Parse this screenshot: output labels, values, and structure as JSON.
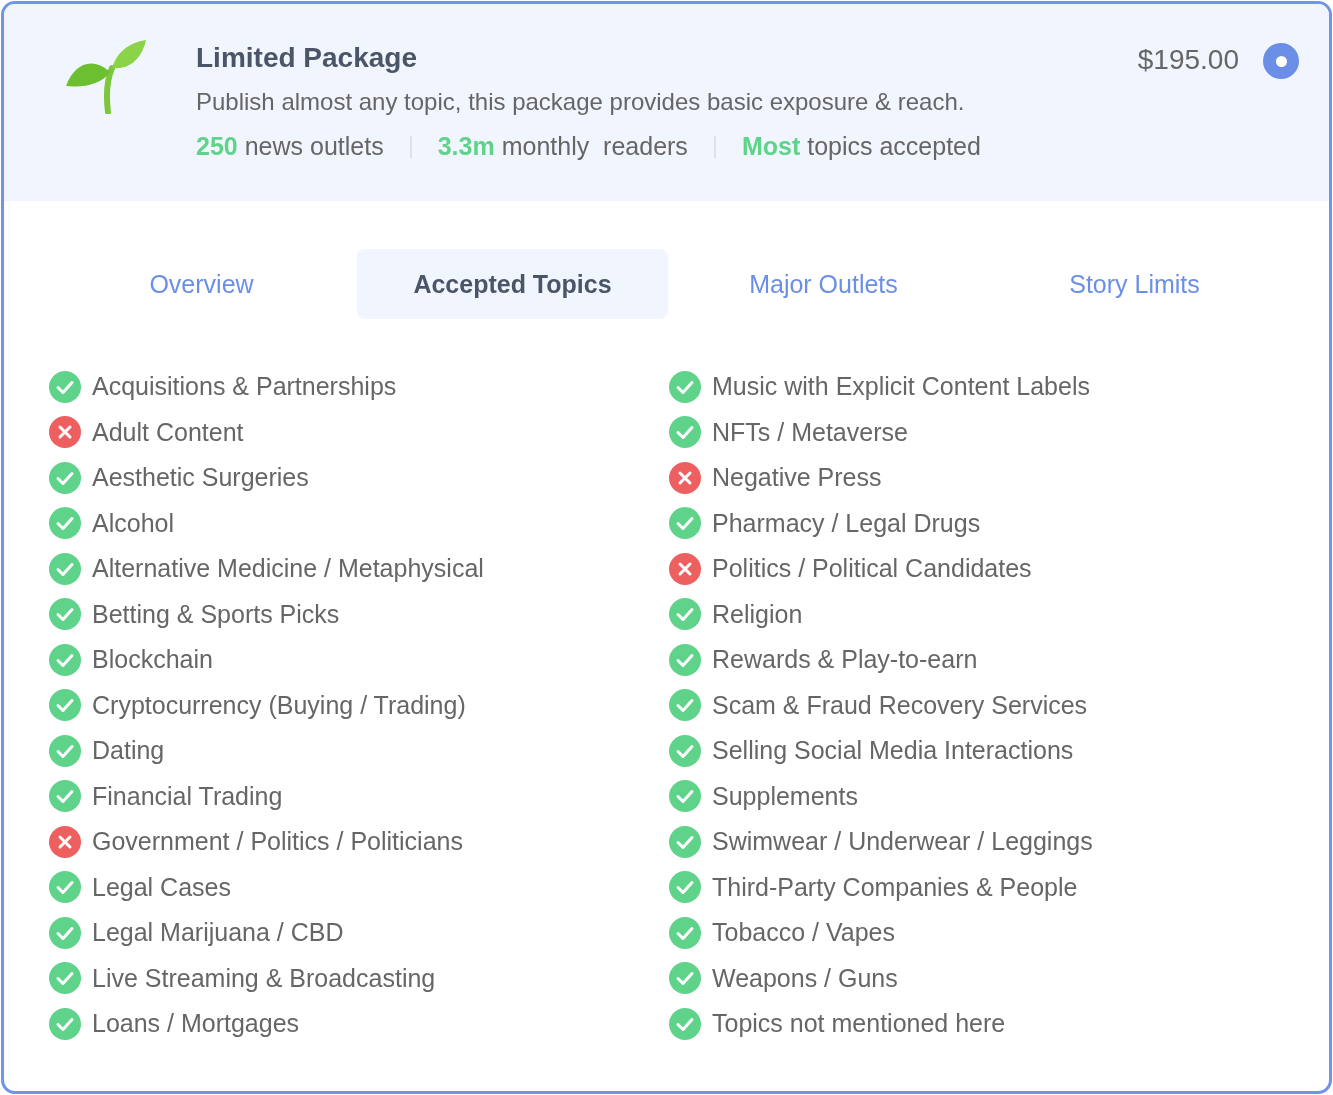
{
  "package": {
    "title": "Limited Package",
    "description": "Publish almost any topic, this package provides basic exposure & reach.",
    "price": "$195.00",
    "selected": true,
    "stats": [
      {
        "value": "250",
        "label": "news outlets"
      },
      {
        "value": "3.3m",
        "label": "monthly  readers"
      },
      {
        "value": "Most",
        "label": "topics accepted"
      }
    ]
  },
  "tabs": [
    {
      "label": "Overview",
      "selected": false
    },
    {
      "label": "Accepted Topics",
      "selected": true
    },
    {
      "label": "Major Outlets",
      "selected": false
    },
    {
      "label": "Story Limits",
      "selected": false
    }
  ],
  "topic_columns": [
    [
      {
        "label": "Acquisitions & Partnerships",
        "accepted": true
      },
      {
        "label": "Adult Content",
        "accepted": false
      },
      {
        "label": "Aesthetic Surgeries",
        "accepted": true
      },
      {
        "label": "Alcohol",
        "accepted": true
      },
      {
        "label": "Alternative Medicine / Metaphysical",
        "accepted": true
      },
      {
        "label": "Betting & Sports Picks",
        "accepted": true
      },
      {
        "label": "Blockchain",
        "accepted": true
      },
      {
        "label": "Cryptocurrency (Buying / Trading)",
        "accepted": true
      },
      {
        "label": "Dating",
        "accepted": true
      },
      {
        "label": "Financial Trading",
        "accepted": true
      },
      {
        "label": "Government / Politics / Politicians",
        "accepted": false
      },
      {
        "label": "Legal Cases",
        "accepted": true
      },
      {
        "label": "Legal Marijuana / CBD",
        "accepted": true
      },
      {
        "label": "Live Streaming & Broadcasting",
        "accepted": true
      },
      {
        "label": "Loans / Mortgages",
        "accepted": true
      }
    ],
    [
      {
        "label": "Music with Explicit Content Labels",
        "accepted": true
      },
      {
        "label": "NFTs / Metaverse",
        "accepted": true
      },
      {
        "label": "Negative Press",
        "accepted": false
      },
      {
        "label": "Pharmacy / Legal Drugs",
        "accepted": true
      },
      {
        "label": "Politics / Political Candidates",
        "accepted": false
      },
      {
        "label": "Religion",
        "accepted": true
      },
      {
        "label": "Rewards & Play-to-earn",
        "accepted": true
      },
      {
        "label": "Scam & Fraud Recovery Services",
        "accepted": true
      },
      {
        "label": "Selling Social Media Interactions",
        "accepted": true
      },
      {
        "label": "Supplements",
        "accepted": true
      },
      {
        "label": "Swimwear / Underwear / Leggings",
        "accepted": true
      },
      {
        "label": "Third-Party Companies & People",
        "accepted": true
      },
      {
        "label": "Tobacco / Vapes",
        "accepted": true
      },
      {
        "label": "Weapons / Guns",
        "accepted": true
      },
      {
        "label": "Topics not mentioned here",
        "accepted": true
      }
    ]
  ]
}
